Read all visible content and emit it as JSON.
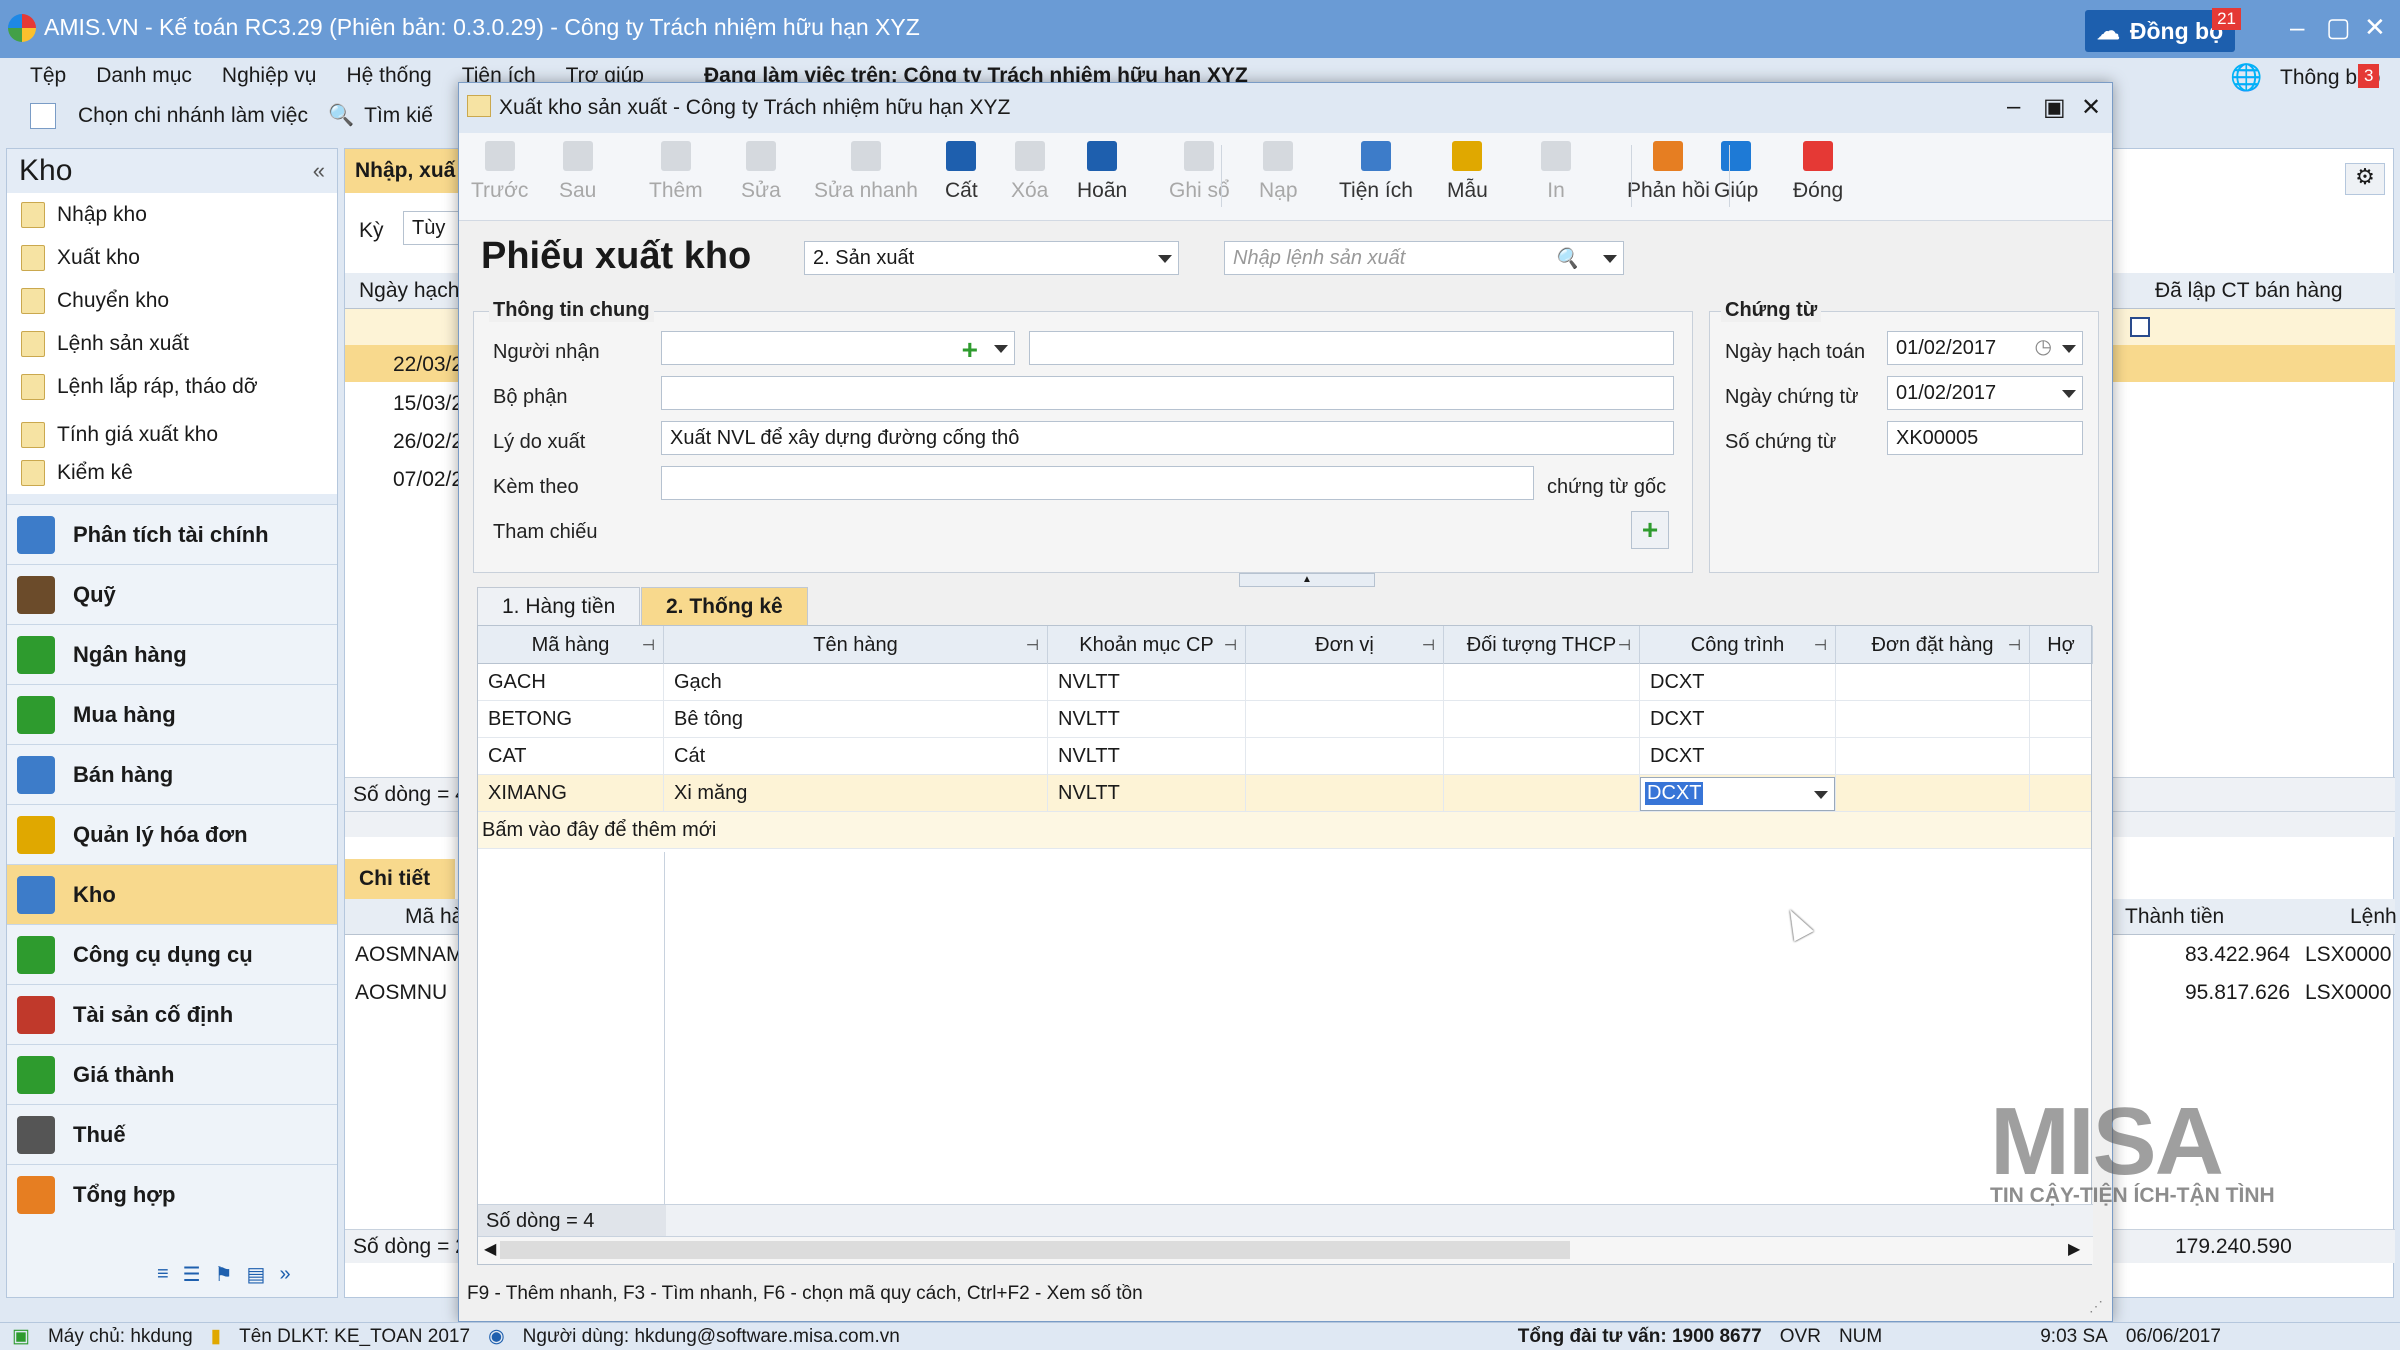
{
  "app": {
    "title": "AMIS.VN - Kế toán RC3.29 (Phiên bản: 0.3.0.29) - Công ty Trách nhiệm hữu hạn XYZ",
    "sync_label": "Đồng bộ",
    "sync_badge": "21",
    "notify_label": "Thông báo",
    "notify_badge": "3"
  },
  "menu": {
    "items": [
      "Tệp",
      "Danh mục",
      "Nghiệp vụ",
      "Hệ thống",
      "Tiện ích",
      "Trợ giúp"
    ],
    "working_on": "Đang làm việc trên: Công ty Trách nhiệm hữu hạn XYZ"
  },
  "cmdbar": {
    "branch": "Chọn chi nhánh làm việc",
    "search": "Tìm kiế"
  },
  "leftnav": {
    "title": "Kho",
    "items": [
      "Nhập kho",
      "Xuất kho",
      "Chuyển kho",
      "Lệnh sản xuất",
      "Lệnh lắp ráp, tháo dỡ",
      "Tính giá xuất kho",
      "Kiểm kê"
    ],
    "modules": [
      "Phân tích tài chính",
      "Quỹ",
      "Ngân hàng",
      "Mua hàng",
      "Bán hàng",
      "Quản lý hóa đơn",
      "Kho",
      "Công cụ dụng cụ",
      "Tài sản cố định",
      "Giá thành",
      "Thuế",
      "Tổng hợp"
    ]
  },
  "bg": {
    "tab": "Nhập, xuấ",
    "ky_label": "Kỳ",
    "ky_value": "Tùy",
    "col_date": "Ngày hạch",
    "dates": [
      "22/03/2",
      "15/03/2",
      "26/02/2",
      "07/02/2"
    ],
    "rowcount": "Số dòng = 4",
    "detail_tab": "Chi tiết",
    "detail_col": "Mã hà",
    "detail_rows": [
      "AOSMNAM",
      "AOSMNU"
    ],
    "rowcount2": "Số dòng = 2",
    "right_col": "Đã lập CT bán hàng",
    "amount_col": "Thành tiền",
    "lenh_col": "Lệnh",
    "amounts": [
      "83.422.964",
      "95.817.626"
    ],
    "lenhs": [
      "LSX0000",
      "LSX0000"
    ],
    "total": "179.240.590"
  },
  "dialog": {
    "title": "Xuất kho sản xuất - Công ty Trách nhiệm hữu hạn XYZ",
    "toolbar": [
      "Trước",
      "Sau",
      "Thêm",
      "Sửa",
      "Sửa nhanh",
      "Cất",
      "Xóa",
      "Hoãn",
      "Ghi sổ",
      "Nạp",
      "Tiện ích",
      "Mẫu",
      "In",
      "Phản hồi",
      "Giúp",
      "Đóng"
    ],
    "form_title": "Phiếu xuất kho",
    "type_value": "2. Sản xuất",
    "order_placeholder": "Nhập lệnh sản xuất",
    "general_title": "Thông tin chung",
    "receiver_label": "Người nhận",
    "dept_label": "Bộ phận",
    "reason_label": "Lý do xuất",
    "reason_value": "Xuất NVL để xây dựng đường cống thô",
    "attach_label": "Kèm theo",
    "attach_suffix": "chứng từ gốc",
    "ref_label": "Tham chiếu",
    "voucher_title": "Chứng từ",
    "acct_date_label": "Ngày hạch toán",
    "acct_date": "01/02/2017",
    "doc_date_label": "Ngày chứng từ",
    "doc_date": "01/02/2017",
    "doc_no_label": "Số chứng từ",
    "doc_no": "XK00005",
    "tabs": [
      "1. Hàng tiền",
      "2. Thống kê"
    ],
    "columns": [
      "Mã hàng",
      "Tên hàng",
      "Khoản mục CP",
      "Đơn vị",
      "Đối tượng THCP",
      "Công trình",
      "Đơn đặt hàng",
      "Hợ"
    ],
    "rows": [
      [
        "GACH",
        "Gạch",
        "NVLTT",
        "",
        "",
        "DCXT",
        ""
      ],
      [
        "BETONG",
        "Bê tông",
        "NVLTT",
        "",
        "",
        "DCXT",
        ""
      ],
      [
        "CAT",
        "Cát",
        "NVLTT",
        "",
        "",
        "DCXT",
        ""
      ],
      [
        "XIMANG",
        "Xi măng",
        "NVLTT",
        "",
        "",
        "DCXT",
        ""
      ]
    ],
    "add_row": "Bấm vào đây để thêm mới",
    "rowcount": "Số dòng = 4",
    "hint": "F9 - Thêm nhanh, F3 - Tìm nhanh, F6 - chọn mã quy cách, Ctrl+F2 - Xem số tồn"
  },
  "watermark": {
    "brand": "MISA",
    "tagline": "TIN CẬY-TIỆN ÍCH-TẬN TÌNH"
  },
  "status": {
    "server": "Máy chủ: hkdung",
    "dlkt": "Tên DLKT: KE_TOAN 2017",
    "user": "Người dùng: hkdung@software.misa.com.vn",
    "hotline": "Tổng đài tư vấn: 1900 8677",
    "ovr": "OVR",
    "num": "NUM",
    "time": "9:03 SA",
    "date": "06/06/2017"
  }
}
